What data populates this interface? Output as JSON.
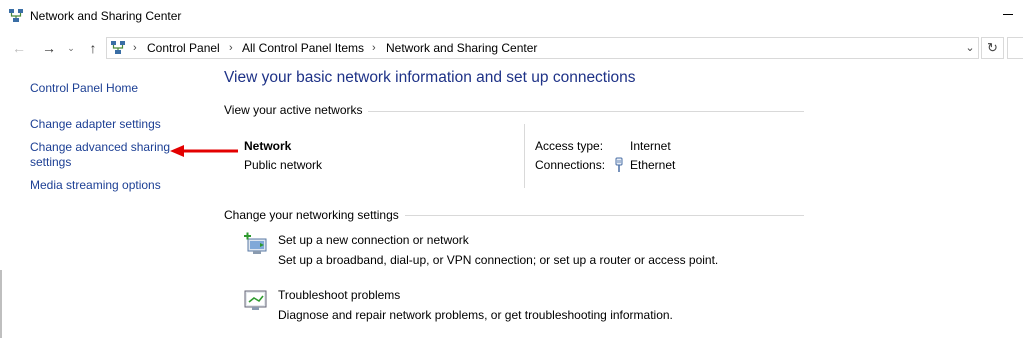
{
  "window": {
    "title": "Network and Sharing Center",
    "title_icon": "network-center-icon"
  },
  "navbar": {
    "back_icon": "back-arrow-icon",
    "forward_icon": "forward-arrow-icon",
    "recent_icon": "chevron-down-icon",
    "up_icon": "up-arrow-icon",
    "breadcrumbs": [
      "Control Panel",
      "All Control Panel Items",
      "Network and Sharing Center"
    ],
    "refresh_icon": "refresh-icon"
  },
  "sidebar": {
    "home": "Control Panel Home",
    "items": [
      {
        "label": "Change adapter settings"
      },
      {
        "label_line1": "Change advanced sharing",
        "label_line2": "settings"
      },
      {
        "label": "Media streaming options"
      }
    ]
  },
  "main": {
    "heading": "View your basic network information and set up connections",
    "active_networks_title": "View your active networks",
    "network": {
      "name": "Network",
      "type": "Public network",
      "access_type_label": "Access type:",
      "access_type_value": "Internet",
      "connections_label": "Connections:",
      "connections_value": "Ethernet"
    },
    "settings_title": "Change your networking settings",
    "tasks": [
      {
        "title": "Set up a new connection or network",
        "desc": "Set up a broadband, dial-up, or VPN connection; or set up a router or access point.",
        "icon": "new-connection-icon"
      },
      {
        "title": "Troubleshoot problems",
        "desc": "Diagnose and repair network problems, or get troubleshooting information.",
        "icon": "troubleshoot-icon"
      }
    ]
  },
  "colors": {
    "link": "#0066cc",
    "heading": "#1e3287",
    "annotation_arrow": "#e30000"
  }
}
